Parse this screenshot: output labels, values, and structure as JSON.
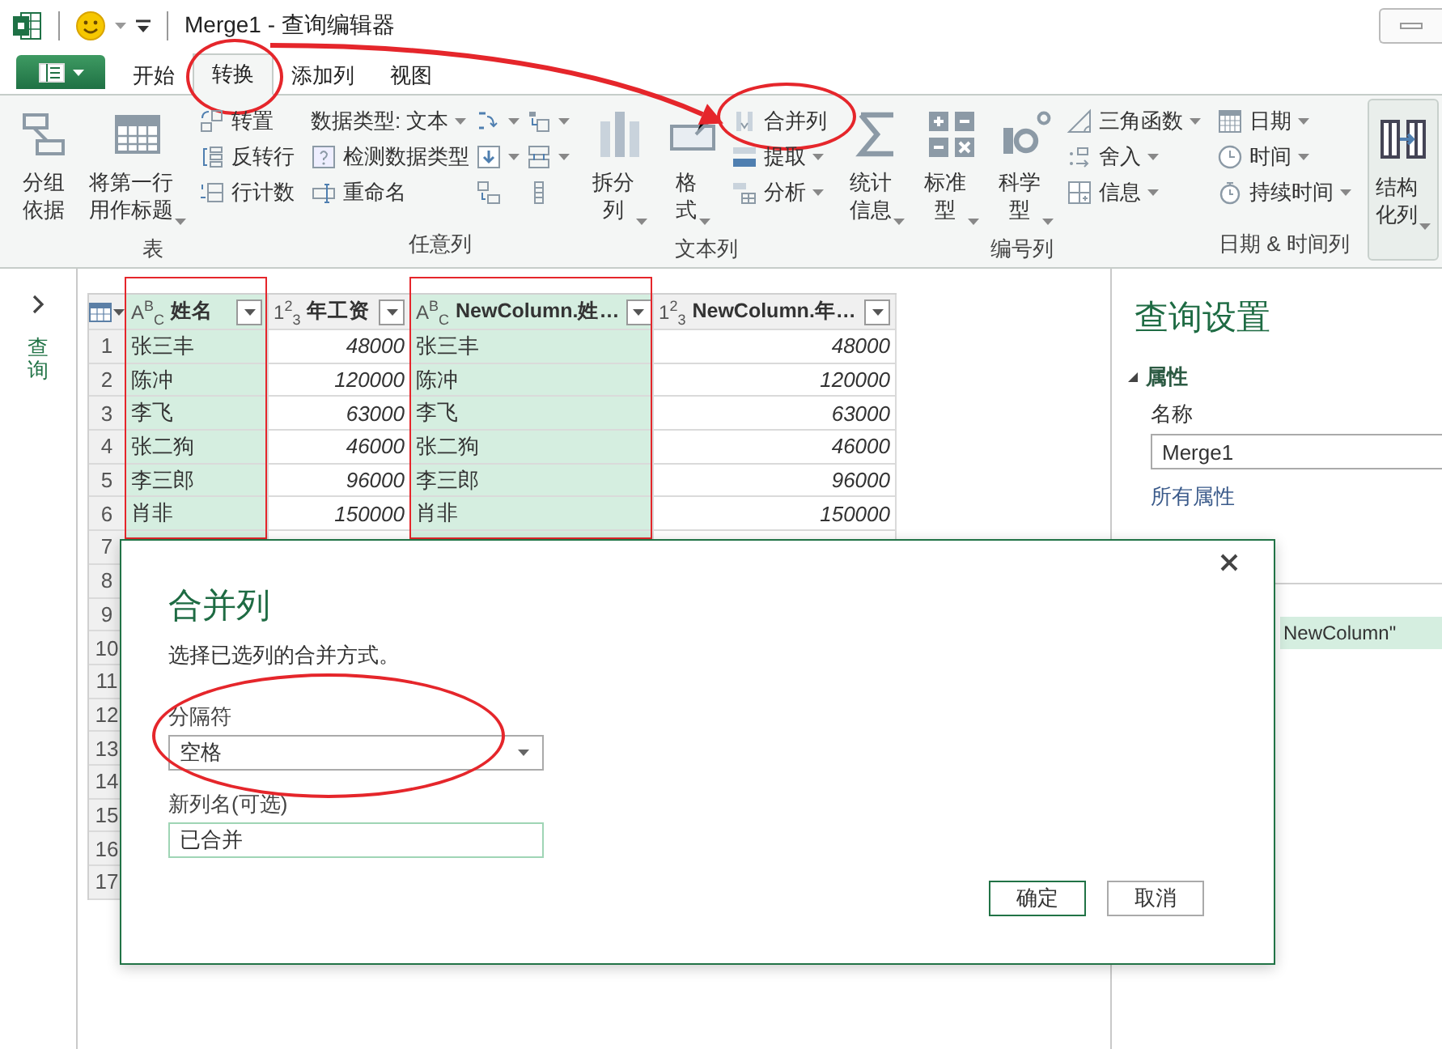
{
  "window": {
    "title": "Merge1 - 查询编辑器"
  },
  "tabs": [
    {
      "label": "开始",
      "selected": false,
      "circled": false
    },
    {
      "label": "转换",
      "selected": true,
      "circled": true
    },
    {
      "label": "添加列",
      "selected": false,
      "circled": false
    },
    {
      "label": "视图",
      "selected": false,
      "circled": false
    }
  ],
  "ribbon": {
    "groups": [
      {
        "label": "表",
        "kind": "plain",
        "columns": [
          {
            "large": {
              "label": "分组依据",
              "kind": "group",
              "dropdown": false,
              "circled": false
            }
          },
          {
            "large": {
              "label": "将第一行用作标题",
              "kind": "header",
              "dropdown": true,
              "circled": false
            }
          },
          {
            "small": [
              {
                "label": "转置",
                "kind": "transpose",
                "dropdown": false,
                "circled": false
              },
              {
                "label": "反转行",
                "kind": "reverse",
                "dropdown": false,
                "circled": false
              },
              {
                "label": "行计数",
                "kind": "count",
                "dropdown": false,
                "circled": false
              }
            ]
          }
        ]
      },
      {
        "label": "任意列",
        "kind": "plain",
        "columns": [
          {
            "small": [
              {
                "label": "数据类型: 文本",
                "kind": "none",
                "dropdown": true,
                "circled": false
              },
              {
                "label": "检测数据类型",
                "kind": "detect",
                "dropdown": false,
                "circled": false
              },
              {
                "label": "重命名",
                "kind": "rename",
                "dropdown": false,
                "circled": false
              }
            ]
          },
          {
            "small": [
              {
                "kind": "replace",
                "dropdown": true,
                "circled": false
              },
              {
                "kind": "filldown",
                "dropdown": true,
                "circled": false
              },
              {
                "kind": "pivot",
                "dropdown": false,
                "circled": false
              }
            ]
          },
          {
            "small": [
              {
                "kind": "move",
                "dropdown": true,
                "circled": false
              },
              {
                "kind": "unpivot",
                "dropdown": true,
                "circled": false
              },
              {
                "kind": "list",
                "dropdown": false,
                "circled": false
              }
            ]
          }
        ]
      },
      {
        "label": "文本列",
        "kind": "plain",
        "columns": [
          {
            "large": {
              "label": "拆分列",
              "kind": "split",
              "dropdown": true,
              "circled": false
            }
          },
          {
            "large": {
              "label": "格式",
              "kind": "format",
              "dropdown": true,
              "circled": false
            }
          },
          {
            "small": [
              {
                "label": "合并列",
                "kind": "merge",
                "dropdown": false,
                "circled": true
              },
              {
                "label": "提取",
                "kind": "extract",
                "dropdown": true,
                "circled": false
              },
              {
                "label": "分析",
                "kind": "parse",
                "dropdown": true,
                "circled": false
              }
            ]
          }
        ]
      },
      {
        "label": "编号列",
        "kind": "plain",
        "columns": [
          {
            "large": {
              "label": "统计信息",
              "kind": "stats",
              "dropdown": true,
              "circled": false
            }
          },
          {
            "large": {
              "label": "标准型",
              "kind": "standard",
              "dropdown": true,
              "circled": false
            }
          },
          {
            "large": {
              "label": "科学型",
              "kind": "scientific",
              "dropdown": true,
              "circled": false
            }
          },
          {
            "small": [
              {
                "label": "三角函数",
                "kind": "trig",
                "dropdown": true,
                "circled": false
              },
              {
                "label": "舍入",
                "kind": "round",
                "dropdown": true,
                "circled": false
              },
              {
                "label": "信息",
                "kind": "info",
                "dropdown": true,
                "circled": false
              }
            ]
          }
        ]
      },
      {
        "label": "日期 & 时间列",
        "kind": "plain",
        "columns": [
          {
            "small": [
              {
                "label": "日期",
                "kind": "date",
                "dropdown": true,
                "circled": false
              },
              {
                "label": "时间",
                "kind": "time",
                "dropdown": true,
                "circled": false
              },
              {
                "label": "持续时间",
                "kind": "duration",
                "dropdown": true,
                "circled": false
              }
            ]
          }
        ]
      },
      {
        "kind": "boxed",
        "columns": [
          {
            "large": {
              "label": "结构化列",
              "kind": "structured",
              "dropdown": true,
              "circled": false
            }
          }
        ]
      }
    ]
  },
  "nav": {
    "label": "查询",
    "expanded": false
  },
  "grid": {
    "columns": [
      {
        "kind": "text",
        "type_icon": "A$^{B}$$_{C}$",
        "name": "姓名",
        "selected": true,
        "outlined": true
      },
      {
        "kind": "number",
        "type_icon": "1$^{2}$$_{3}$",
        "name": "年工资",
        "selected": false,
        "outlined": false
      },
      {
        "kind": "text",
        "type_icon": "A$^{B}$$_{C}$",
        "name": "NewColumn.姓…",
        "selected": true,
        "outlined": true
      },
      {
        "kind": "number",
        "type_icon": "1$^{2}$$_{3}$",
        "name": "NewColumn.年…",
        "selected": false,
        "outlined": false
      }
    ],
    "rows": [
      {
        "number": "1",
        "cells": [
          "张三丰",
          "48000",
          "张三丰",
          "48000"
        ]
      },
      {
        "number": "2",
        "cells": [
          "陈冲",
          "120000",
          "陈冲",
          "120000"
        ]
      },
      {
        "number": "3",
        "cells": [
          "李飞",
          "63000",
          "李飞",
          "63000"
        ]
      },
      {
        "number": "4",
        "cells": [
          "张二狗",
          "46000",
          "张二狗",
          "46000"
        ]
      },
      {
        "number": "5",
        "cells": [
          "李三郎",
          "96000",
          "李三郎",
          "96000"
        ]
      },
      {
        "number": "6",
        "cells": [
          "肖非",
          "150000",
          "肖非",
          "150000"
        ]
      },
      {
        "number": "7"
      },
      {
        "number": "8"
      },
      {
        "number": "9"
      },
      {
        "number": "10"
      },
      {
        "number": "11"
      },
      {
        "number": "12"
      },
      {
        "number": "13"
      },
      {
        "number": "14"
      },
      {
        "number": "15"
      },
      {
        "number": "16"
      },
      {
        "number": "17"
      }
    ]
  },
  "settings": {
    "title": "查询设置",
    "properties": {
      "heading": "属性",
      "expanded": true,
      "name_label": "名称",
      "name_value": "Merge1",
      "link": "所有属性"
    },
    "steps": [
      {
        "label": "NewColumn\"",
        "selected": true
      }
    ]
  },
  "dialog": {
    "title": "合并列",
    "description": "选择已选列的合并方式。",
    "separator": {
      "label": "分隔符",
      "value": "空格",
      "circled": true
    },
    "new_name": {
      "label": "新列名(可选)",
      "value": "已合并"
    },
    "buttons": [
      {
        "label": "确定",
        "default": true
      },
      {
        "label": "取消",
        "default": false
      }
    ]
  }
}
